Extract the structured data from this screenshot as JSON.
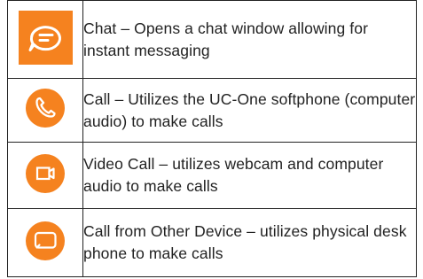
{
  "colors": {
    "accent": "#F5821F",
    "border": "#222222",
    "text": "#222222"
  },
  "rows": [
    {
      "icon": "chat-bubble-icon",
      "text": "Chat – Opens a chat window allowing for instant messaging"
    },
    {
      "icon": "phone-handset-icon",
      "text": "Call – Utilizes the UC-One softphone (computer audio) to make calls"
    },
    {
      "icon": "video-camera-icon",
      "text": "Video Call – utilizes webcam and computer audio to make calls"
    },
    {
      "icon": "desk-phone-icon",
      "text": "Call from Other Device – utilizes physical desk phone to make calls"
    }
  ]
}
